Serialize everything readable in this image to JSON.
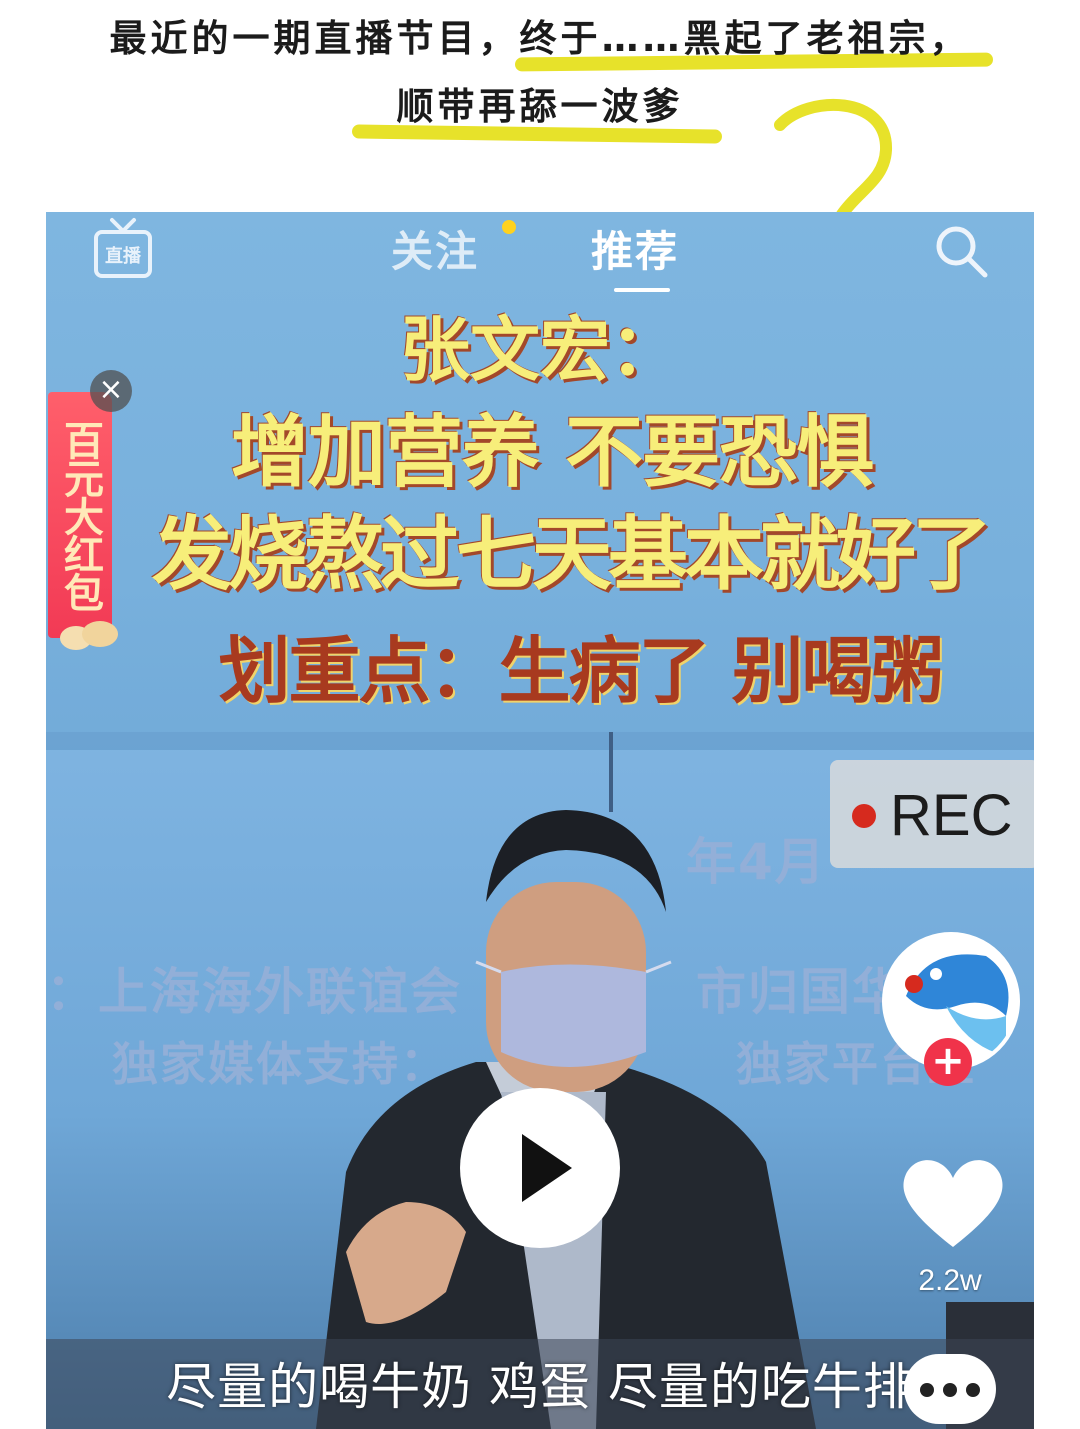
{
  "caption": {
    "line1": "最近的一期直播节目，终于……黑起了老祖宗，",
    "line2": "顺带再舔一波爹"
  },
  "app": {
    "tabs": [
      {
        "label": "关注",
        "active": false
      },
      {
        "label": "推荐",
        "active": true
      }
    ],
    "logo_icon": "tv-live-icon",
    "search_icon": "search-icon"
  },
  "headline": {
    "name": "张文宏：",
    "line1": "增加营养 不要恐惧",
    "line2": "发烧熬过七天基本就好了",
    "line3": "划重点：生病了 别喝粥"
  },
  "red_packet": {
    "label": "百元大红包",
    "close": "×"
  },
  "background_board": {
    "row1": "年4月",
    "row2_left": "：上海海外联谊会",
    "row2_right": "市归国华",
    "row3_left": "独家媒体支持：",
    "row3_right": "独家平台直"
  },
  "rec": {
    "label": "REC"
  },
  "sidebar": {
    "avatar_plus": "+",
    "like_count": "2.2w"
  },
  "subtitle": "尽量的喝牛奶 鸡蛋 尽量的吃牛排",
  "colors": {
    "underline": "#e7e22a",
    "headline_yellow": "#f7ee7a",
    "headline_red": "#a83a1f",
    "red_packet": "#f23a55",
    "rec_dot": "#d62a1e",
    "plus_badge": "#f0334a"
  }
}
